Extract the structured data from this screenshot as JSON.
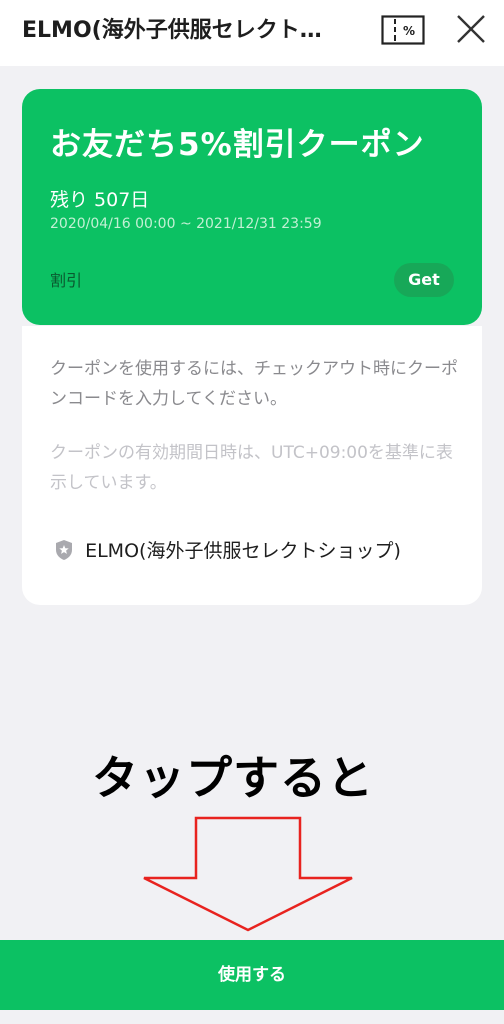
{
  "header": {
    "title": "ELMO(海外子供服セレクト…",
    "coupon_icon": "coupon-percent-icon",
    "close_icon": "close-icon"
  },
  "coupon": {
    "title": "お友だち5%割引クーポン",
    "remaining": "残り  507日",
    "period": "2020/04/16 00:00 ~ 2021/12/31 23:59",
    "type_label": "割引",
    "get_label": "Get",
    "color": "#0cc163"
  },
  "info": {
    "usage_text": "クーポンを使用するには、チェックアウト時にクーポンコードを入力してください。",
    "timezone_text": "クーポンの有効期間日時は、UTC+09:00を基準に表示しています。",
    "shop_icon": "shield-star-icon",
    "shop_name": "ELMO(海外子供服セレクトショップ)"
  },
  "annotation": {
    "text": "タップすると",
    "arrow_icon": "arrow-down-icon",
    "arrow_color": "#e8231f"
  },
  "footer": {
    "use_button_label": "使用する"
  }
}
